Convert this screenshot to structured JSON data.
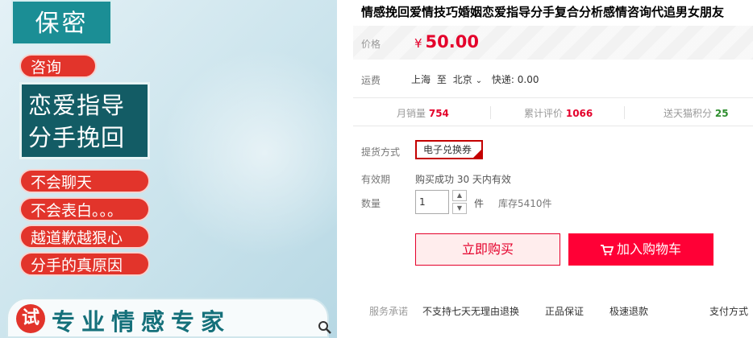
{
  "product_image": {
    "secret_tag": "保密",
    "consult_tag": "咨询",
    "headline_line1": "恋爱指导",
    "headline_line2": "分手挽回",
    "bullets": [
      "不会聊天",
      "不会表白。。。",
      "越道歉越狠心",
      "分手的真原因"
    ],
    "try_badge": "试",
    "bottom_slogan": "专业情感专家",
    "zoom_icon": "magnifier-icon"
  },
  "product": {
    "title": "情感挽回爱情技巧婚姻恋爱指导分手复合分析感情咨询代追男女朋友",
    "price_label": "价格",
    "price_currency": "¥",
    "price_value": "50.00",
    "shipping_label": "运费",
    "ship_from": "上海",
    "ship_to_word": "至",
    "ship_to": "北京",
    "shipping_fee": "快递: 0.00"
  },
  "stats": {
    "monthly_sales_label": "月销量",
    "monthly_sales_value": "754",
    "reviews_label": "累计评价",
    "reviews_value": "1066",
    "points_label": "送天猫积分",
    "points_value": "25"
  },
  "options": {
    "delivery_label": "提货方式",
    "delivery_value": "电子兑换券",
    "validity_label": "有效期",
    "validity_text": "购买成功 30 天内有效",
    "quantity_label": "数量",
    "quantity_value": "1",
    "quantity_unit": "件",
    "stock_text": "库存5410件"
  },
  "actions": {
    "buy_now": "立即购买",
    "add_to_cart": "加入购物车"
  },
  "service": {
    "label": "服务承诺",
    "items": [
      "不支持七天无理由退换",
      "正品保证",
      "极速退款",
      "支付方式"
    ]
  },
  "colors": {
    "accent_red": "#e4002b",
    "cart_red": "#ff0036",
    "teal": "#135c65",
    "points_green": "#2d8d2d"
  }
}
